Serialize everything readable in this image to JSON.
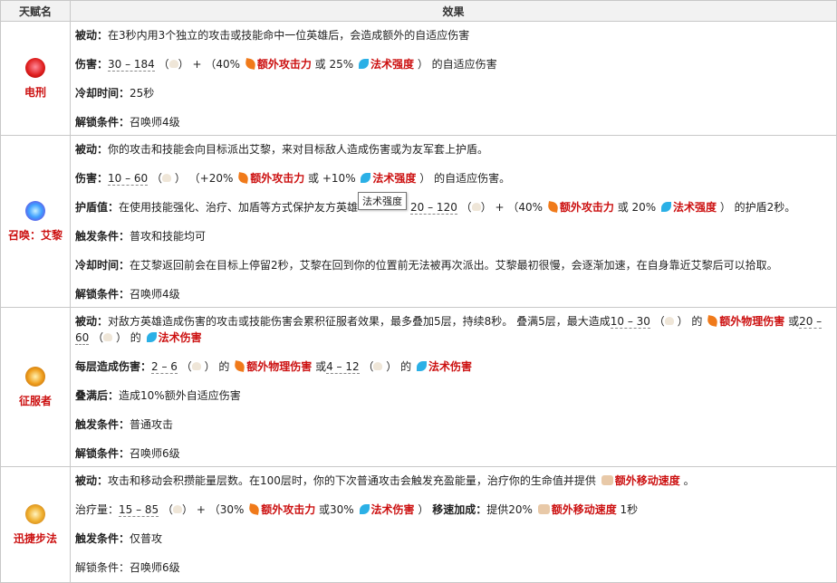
{
  "header": {
    "col_name": "天赋名",
    "col_effect": "效果"
  },
  "tooltip": "法术强度",
  "rows": [
    {
      "name": "电刑",
      "color": "#e02020",
      "passive_label": "被动：",
      "passive": "在3秒内用3个独立的攻击或技能命中一位英雄后，会造成额外的自适应伤害",
      "dmg_label": "伤害：",
      "dmg_range": "30 – 184",
      "dmg_mid": "） + （40% ",
      "ad_text": "额外攻击力",
      "dmg_or": " 或 25% ",
      "ap_text": "法术强度",
      "dmg_end": "） 的自适应伤害",
      "cd_label": "冷却时间：",
      "cd": "25秒",
      "unlock_label": "解锁条件：",
      "unlock": "召唤师4级"
    },
    {
      "name": "召唤：艾黎",
      "color": "#3fa0ff",
      "passive_label": "被动：",
      "passive": "你的攻击和技能会向目标派出艾黎，来对目标敌人造成伤害或为友军套上护盾。",
      "dmg_label": "伤害：",
      "dmg_range": "10 – 60",
      "dmg_mid": "） （+20% ",
      "ad_text": "额外攻击力",
      "dmg_or": " 或 +10% ",
      "ap_text": "法术强度",
      "dmg_end": "） 的自适应伤害。",
      "shield_label": "护盾值：",
      "shield_pre": "在使用技能强化、治疗、加盾等方式保护友方英雄",
      "shield_range": "20 – 120",
      "shield_mid": "） + （40% ",
      "shield_ad": "额外攻击力",
      "shield_or": " 或 20% ",
      "shield_ap": "法术强度",
      "shield_end": "） 的护盾2秒。",
      "trigger_label": "触发条件：",
      "trigger": "普攻和技能均可",
      "cd_label": "冷却时间：",
      "cd": "在艾黎返回前会在目标上停留2秒，艾黎在回到你的位置前无法被再次派出。艾黎最初很慢，会逐渐加速，在自身靠近艾黎后可以拾取。",
      "unlock_label": "解锁条件：",
      "unlock": "召唤师4级"
    },
    {
      "name": "征服者",
      "color": "#f0a020",
      "passive_label": "被动：",
      "passive": "对敌方英雄造成伤害的攻击或技能伤害会累积征服者效果，最多叠加5层，持续8秒。 叠满5层，最大造成",
      "p_r1": "10 – 30",
      "p_de": "） 的 ",
      "p_phys": "额外物理伤害",
      "p_or": " 或",
      "p_r2": "20 – 60",
      "p_magic": "法术伤害",
      "stack_label": "每层造成伤害：",
      "s_r1": "2 – 6",
      "s_phys": "额外物理伤害",
      "s_or": " 或",
      "s_r2": "4 – 12",
      "s_magic": "法术伤害",
      "full_label": "叠满后：",
      "full": "造成10%额外自适应伤害",
      "trigger_label": "触发条件：",
      "trigger": "普通攻击",
      "unlock_label": "解锁条件：",
      "unlock": "召唤师6级"
    },
    {
      "name": "迅捷步法",
      "color": "#f0b030",
      "passive_label": "被动：",
      "passive": "攻击和移动会积攒能量层数。在100层时，你的下次普通攻击会触发充盈能量，治疗你的生命值并提供 ",
      "passive_ms": "额外移动速度",
      "heal_label": "治疗量：",
      "heal_range": "15 – 85",
      "heal_mid": "） + （30% ",
      "heal_ad": "额外攻击力",
      "heal_or": " 或30% ",
      "heal_ap": "法术伤害",
      "heal_close": "） ",
      "speed_label": "移速加成：",
      "speed_pre": "提供20% ",
      "speed_ms": "额外移动速度",
      "speed_end": " 1秒",
      "trigger_label": "触发条件：",
      "trigger": "仅普攻",
      "unlock_label": "解锁条件：",
      "unlock": "召唤师6级"
    }
  ],
  "paren_open": "（",
  "paren_close": "）",
  "period": " 。",
  "de": "） 的 "
}
